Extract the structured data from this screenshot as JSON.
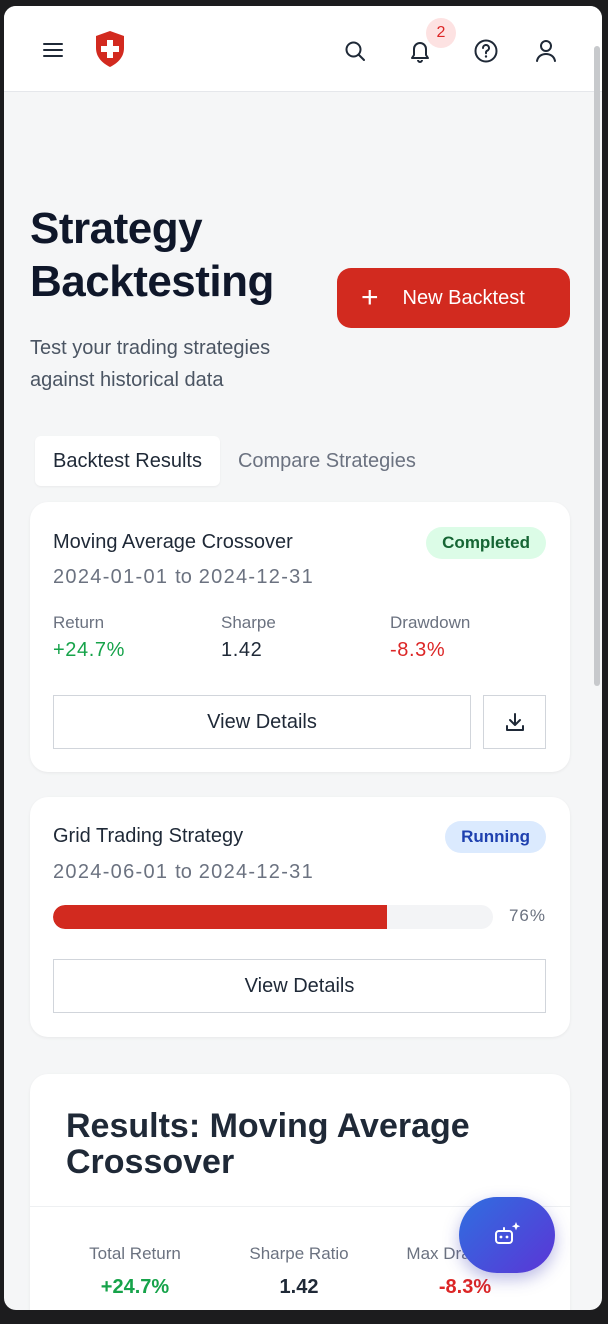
{
  "header": {
    "notification_count": "2",
    "icons": [
      "menu-icon",
      "shield-cross-logo",
      "search-icon",
      "bell-icon",
      "help-icon",
      "user-icon"
    ]
  },
  "page": {
    "title": "Strategy Backtesting",
    "subtitle": "Test your trading strategies against historical data",
    "new_button_icon": "+",
    "new_button_label": "New Backtest"
  },
  "tabs": [
    {
      "label": "Backtest Results",
      "active": true
    },
    {
      "label": "Compare Strategies",
      "active": false
    }
  ],
  "backtests": [
    {
      "name": "Moving Average Crossover",
      "status": "Completed",
      "date_from": "2024-01-01",
      "date_to": "2024-12-31",
      "date_sep": "to",
      "metrics": [
        {
          "label": "Return",
          "value": "+24.7%"
        },
        {
          "label": "Sharpe",
          "value": "1.42"
        },
        {
          "label": "Drawdown",
          "value": "-8.3%"
        }
      ],
      "details_label": "View Details"
    },
    {
      "name": "Grid Trading Strategy",
      "status": "Running",
      "date_from": "2024-06-01",
      "date_to": "2024-12-31",
      "date_sep": "to",
      "progress_percent": 76,
      "progress_label": "76%",
      "details_label": "View Details"
    }
  ],
  "results": {
    "title": "Results: Moving Average Crossover",
    "metrics": [
      {
        "label": "Total Return",
        "value": "+24.7%"
      },
      {
        "label": "Sharpe Ratio",
        "value": "1.42"
      },
      {
        "label": "Max Drawdown",
        "value": "-8.3%"
      }
    ]
  },
  "colors": {
    "brand_red": "#d22a1f",
    "positive": "#16a34a",
    "negative": "#dc2626",
    "fab_gradient_start": "#2f6fe0",
    "fab_gradient_end": "#5b35d6"
  }
}
